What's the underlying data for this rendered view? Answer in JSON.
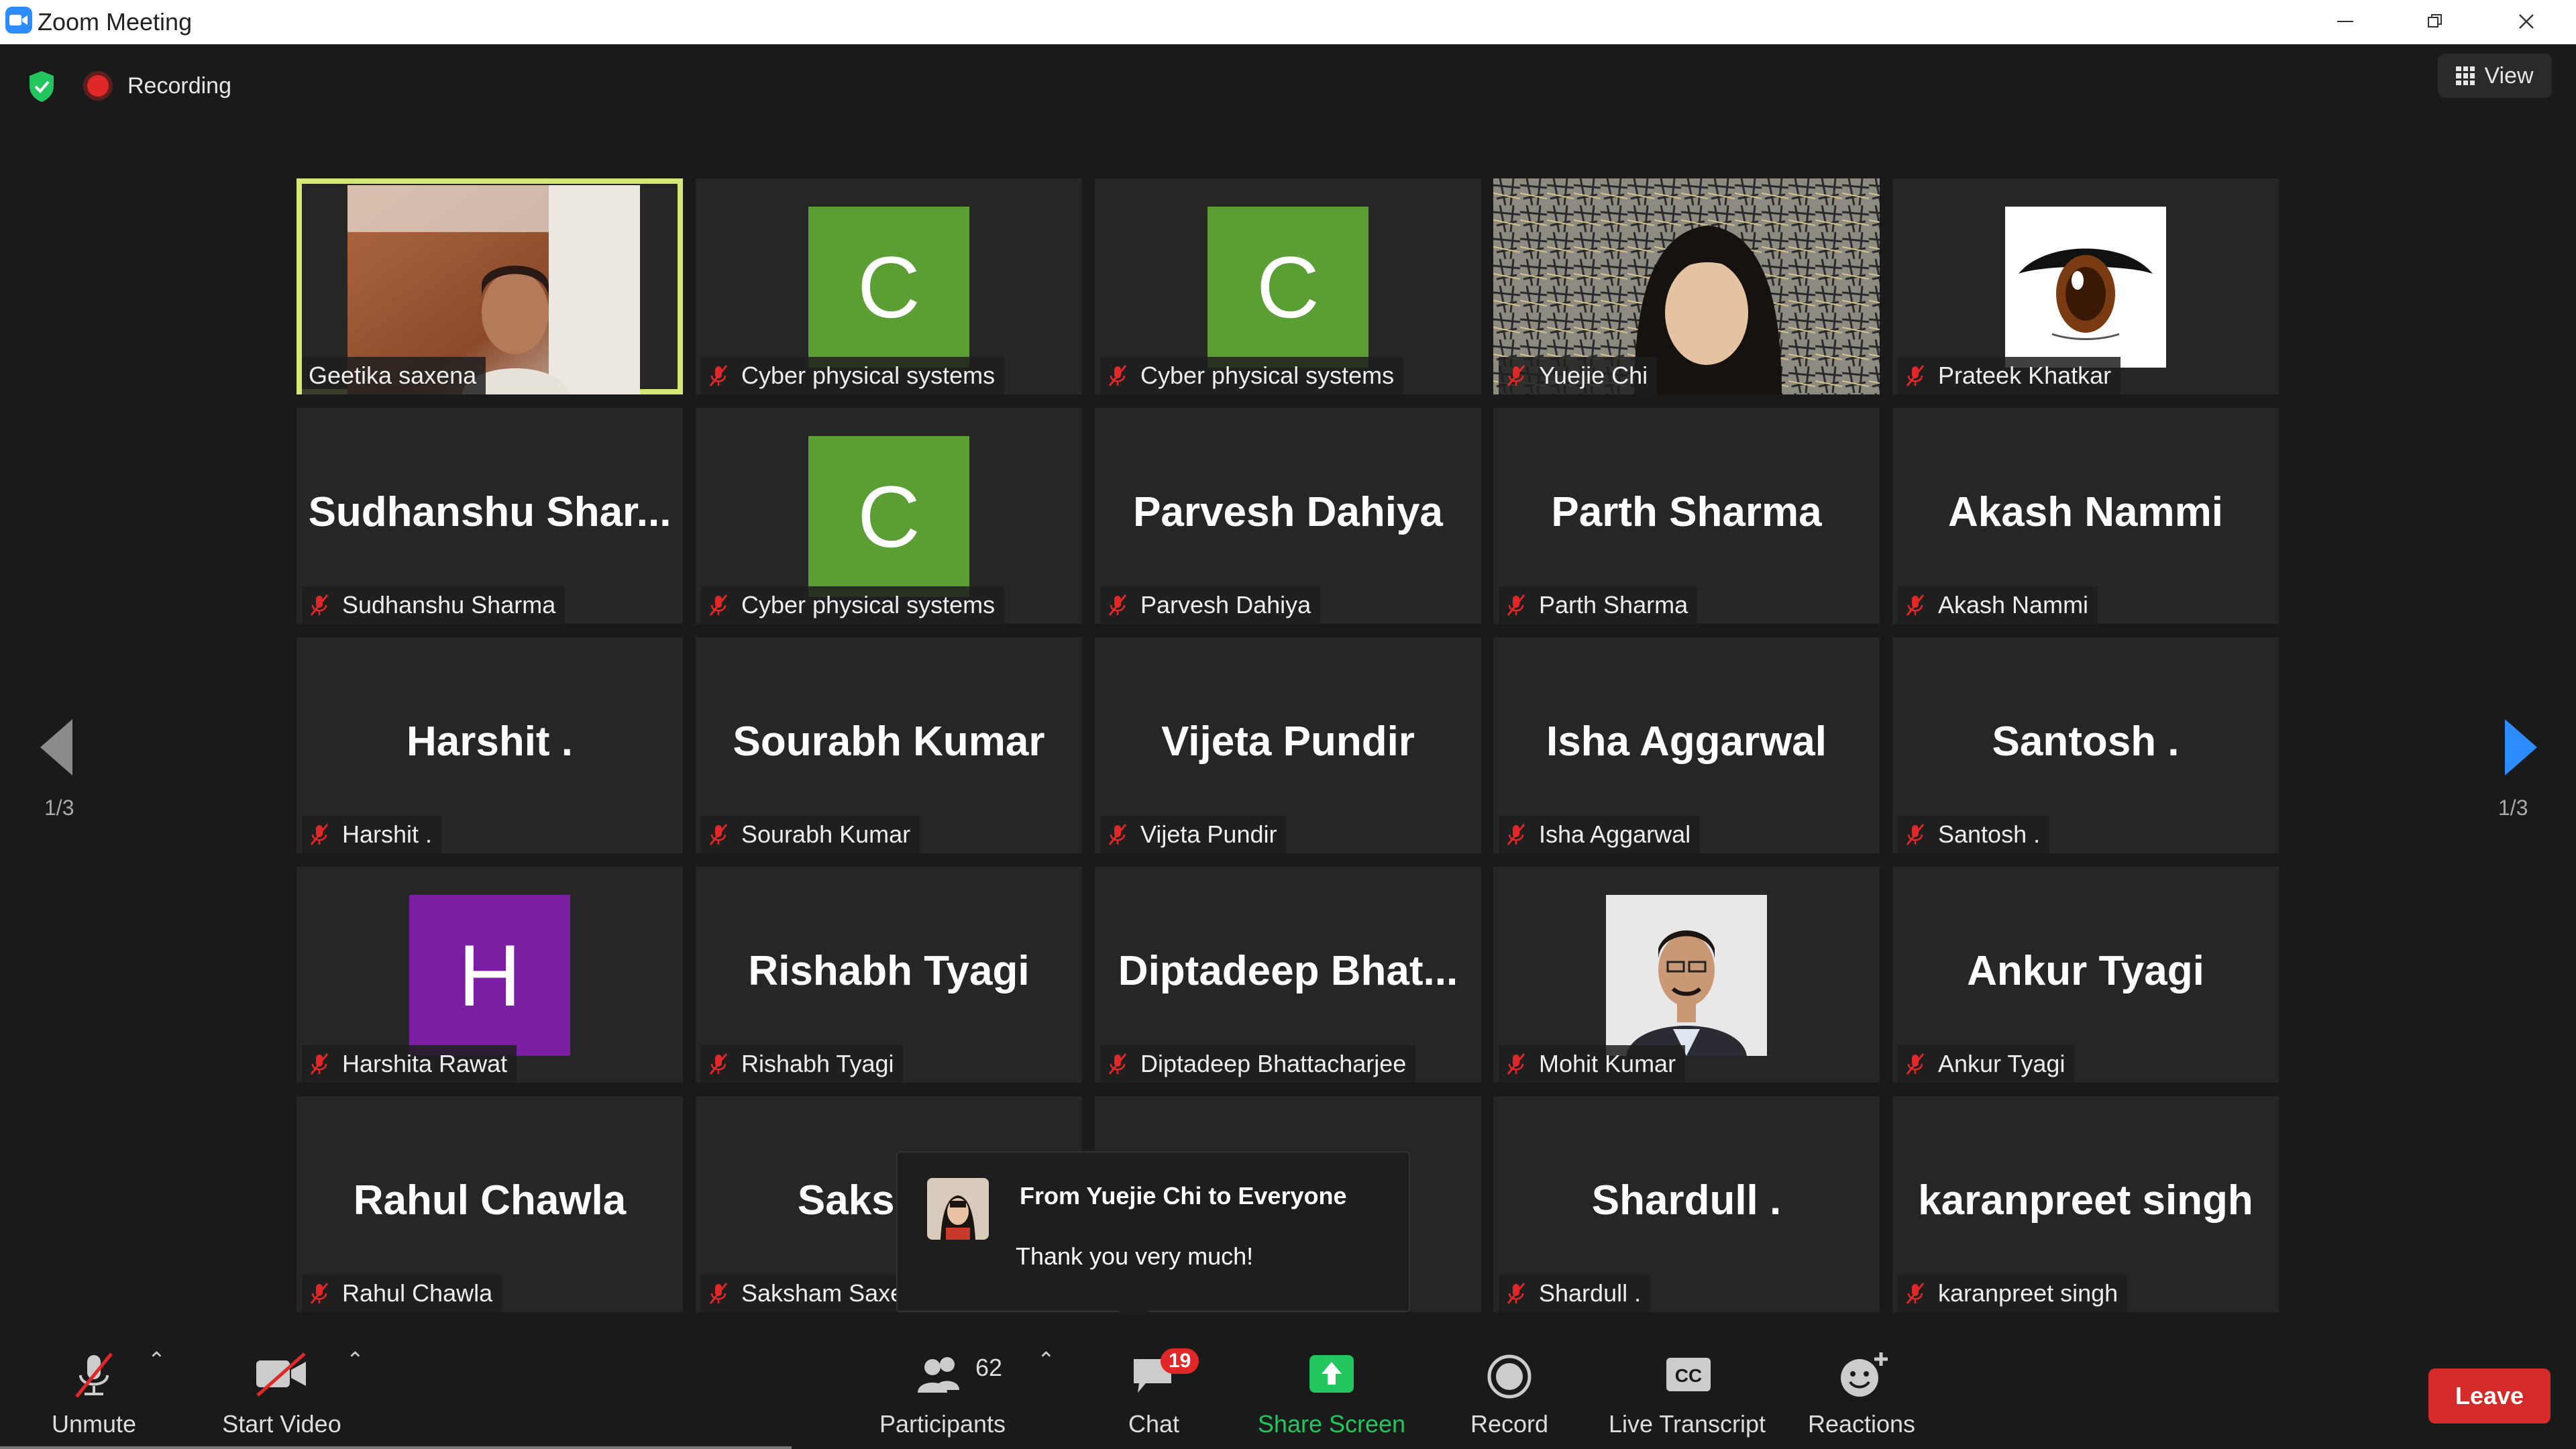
{
  "window": {
    "title": "Zoom Meeting"
  },
  "top": {
    "recording_label": "Recording",
    "view_label": "View"
  },
  "pager": {
    "left": "1/3",
    "right": "1/3"
  },
  "tiles": [
    {
      "label": "Geetika saxena",
      "kind": "video",
      "active": true
    },
    {
      "label": "Cyber physical systems",
      "kind": "avatar",
      "letter": "C",
      "color": "#5b9e34"
    },
    {
      "label": "Cyber physical systems",
      "kind": "avatar",
      "letter": "C",
      "color": "#5b9e34"
    },
    {
      "label": "Yuejie Chi",
      "kind": "video"
    },
    {
      "label": "Prateek Khatkar",
      "kind": "image"
    },
    {
      "label": "Sudhanshu Sharma",
      "kind": "name",
      "display": "Sudhanshu  Shar..."
    },
    {
      "label": "Cyber physical systems",
      "kind": "avatar",
      "letter": "C",
      "color": "#5b9e34"
    },
    {
      "label": "Parvesh Dahiya",
      "kind": "name",
      "display": "Parvesh Dahiya"
    },
    {
      "label": "Parth Sharma",
      "kind": "name",
      "display": "Parth Sharma"
    },
    {
      "label": "Akash Nammi",
      "kind": "name",
      "display": "Akash Nammi"
    },
    {
      "label": "Harshit .",
      "kind": "name",
      "display": "Harshit ."
    },
    {
      "label": "Sourabh Kumar",
      "kind": "name",
      "display": "Sourabh Kumar"
    },
    {
      "label": "Vijeta Pundir",
      "kind": "name",
      "display": "Vijeta Pundir"
    },
    {
      "label": "Isha Aggarwal",
      "kind": "name",
      "display": "Isha Aggarwal"
    },
    {
      "label": "Santosh .",
      "kind": "name",
      "display": "Santosh ."
    },
    {
      "label": "Harshita Rawat",
      "kind": "avatar",
      "letter": "H",
      "color": "#7b1fa2"
    },
    {
      "label": "Rishabh Tyagi",
      "kind": "name",
      "display": "Rishabh Tyagi"
    },
    {
      "label": "Diptadeep Bhattacharjee",
      "kind": "name",
      "display": "Diptadeep  Bhat..."
    },
    {
      "label": "Mohit Kumar",
      "kind": "image"
    },
    {
      "label": "Ankur Tyagi",
      "kind": "name",
      "display": "Ankur Tyagi"
    },
    {
      "label": "Rahul Chawla",
      "kind": "name",
      "display": "Rahul Chawla"
    },
    {
      "label": "Saksham Saxe",
      "kind": "name",
      "display": "Saksham"
    },
    {
      "label": "",
      "kind": "name",
      "display": "na"
    },
    {
      "label": "Shardull .",
      "kind": "name",
      "display": "Shardull ."
    },
    {
      "label": "karanpreet singh",
      "kind": "name",
      "display": "karanpreet singh"
    }
  ],
  "chat_popup": {
    "from": "From Yuejie Chi to Everyone",
    "message": "Thank you very much!"
  },
  "toolbar": {
    "unmute": "Unmute",
    "start_video": "Start Video",
    "participants": "Participants",
    "participants_count": "62",
    "chat": "Chat",
    "chat_badge": "19",
    "share_screen": "Share Screen",
    "record": "Record",
    "live_transcript": "Live Transcript",
    "reactions": "Reactions",
    "leave": "Leave"
  },
  "colors": {
    "active_border": "#d4e877",
    "share_green": "#22c55e",
    "leave_red": "#d52a2a",
    "nav_blue": "#2d8cff"
  }
}
